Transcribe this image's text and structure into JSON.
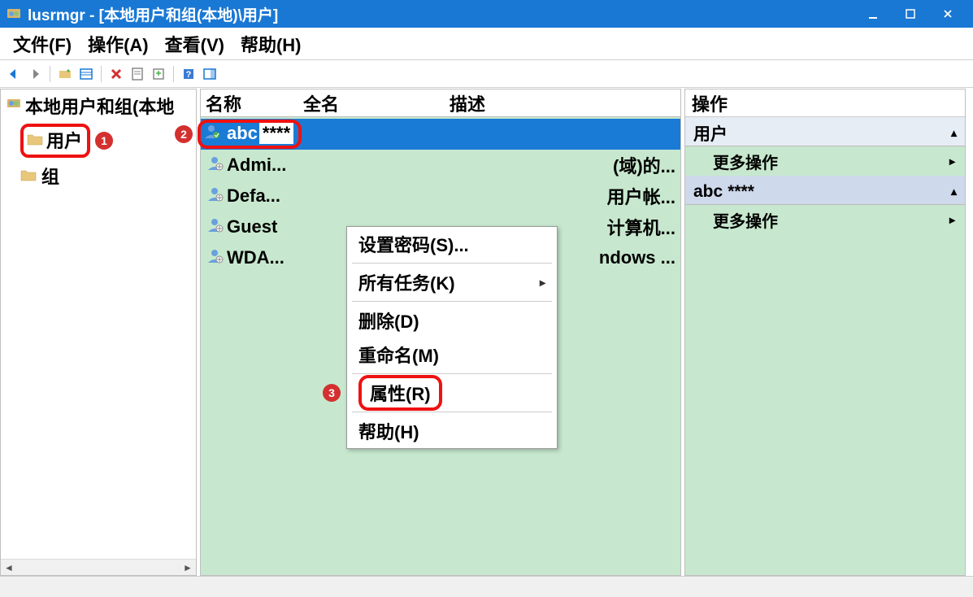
{
  "title": "lusrmgr - [本地用户和组(本地)\\用户]",
  "menubar": {
    "file": "文件(F)",
    "action": "操作(A)",
    "view": "查看(V)",
    "help": "帮助(H)"
  },
  "tree": {
    "root": "本地用户和组(本地",
    "items": [
      {
        "label": "用户"
      },
      {
        "label": "组"
      }
    ]
  },
  "callouts": {
    "one": "1",
    "two": "2",
    "three": "3"
  },
  "columns": {
    "name": "名称",
    "fullname": "全名",
    "desc": "描述"
  },
  "users": [
    {
      "name": "abc",
      "masked": "****",
      "desc": ""
    },
    {
      "name": "Admi...",
      "desc": "(域)的..."
    },
    {
      "name": "Defa...",
      "desc": "用户帐..."
    },
    {
      "name": "Guest",
      "desc": "计算机..."
    },
    {
      "name": "WDA...",
      "desc": "ndows ..."
    }
  ],
  "ctx": {
    "setpwd": "设置密码(S)...",
    "alltasks": "所有任务(K)",
    "delete": "删除(D)",
    "rename": "重命名(M)",
    "props": "属性(R)",
    "help": "帮助(H)"
  },
  "actions": {
    "header": "操作",
    "user_section": "用户",
    "more": "更多操作",
    "selected": "abc",
    "selected_mask": "****"
  }
}
